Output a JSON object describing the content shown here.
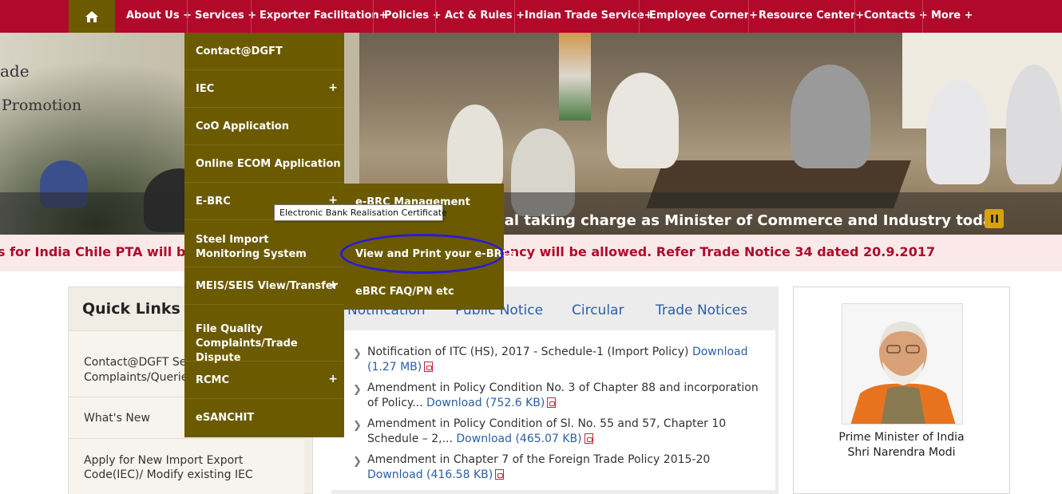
{
  "nav": {
    "home_icon": "home-icon",
    "items": [
      "About Us +",
      "Services +",
      "Exporter Facilitation+",
      "Policies +",
      "Act & Rules +",
      "Indian Trade Service+",
      "Employee Corner+",
      "Resource Center+",
      "Contacts +",
      "More +"
    ]
  },
  "hero": {
    "slogan_line1": "ade",
    "slogan_line2": "Promotion",
    "caption": "yal taking charge as Minister of Commerce and Industry today",
    "pause_icon": "pause-icon"
  },
  "ticker": {
    "text": "s for India Chile PTA will be issued ... plications to EIA or any other agency will be allowed. Refer Trade Notice 34 dated 20.9.2017"
  },
  "services_menu": [
    {
      "label": "Contact@DGFT",
      "plus": ""
    },
    {
      "label": "IEC",
      "plus": "+"
    },
    {
      "label": "CoO Application",
      "plus": ""
    },
    {
      "label": "Online ECOM Application",
      "plus": ""
    },
    {
      "label": "E-BRC",
      "plus": "+"
    },
    {
      "label": "Steel Import Monitoring System",
      "plus": ""
    },
    {
      "label": "MEIS/SEIS View/Transfer",
      "plus": "+"
    },
    {
      "label": "File Quality Complaints/Trade Dispute",
      "plus": ""
    },
    {
      "label": "RCMC",
      "plus": "+"
    },
    {
      "label": "eSANCHIT",
      "plus": ""
    }
  ],
  "ebrc_submenu": [
    "e-BRC Management",
    "View and Print your e-BRCs",
    "eBRC FAQ/PN etc"
  ],
  "tooltip": "Electronic Bank Realisation Certificate",
  "quick_links": {
    "title": "Quick Links",
    "items": [
      "Contact@DGFT Services/ Complaints/Queries",
      "What's New",
      "Apply for New Import Export Code(IEC)/ Modify existing IEC"
    ]
  },
  "tabs": [
    "Notification",
    "Public Notice",
    "Circular",
    "Trade Notices"
  ],
  "notifications": [
    {
      "text": "Notification of ITC (HS), 2017 - Schedule-1 (Import Policy)",
      "link": "Download (1.27 MB)"
    },
    {
      "text": "Amendment in Policy Condition No. 3 of Chapter 88 and incorporation of Policy...",
      "link": "Download (752.6 KB)"
    },
    {
      "text": "Amendment in Policy Condition of Sl. No. 55 and 57, Chapter 10 Schedule – 2,...",
      "link": "Download (465.07 KB)"
    },
    {
      "text": "Amendment in Chapter 7 of the Foreign Trade Policy 2015-20",
      "link": "Download (416.58 KB)"
    }
  ],
  "pm": {
    "title": "Prime Minister of India",
    "name": "Shri Narendra Modi"
  },
  "colors": {
    "nav_bg": "#b2092a",
    "menu_bg": "#6b5a00",
    "ticker_text": "#b2092a",
    "link": "#2a5ea8",
    "annotation": "#2a1ad8"
  }
}
